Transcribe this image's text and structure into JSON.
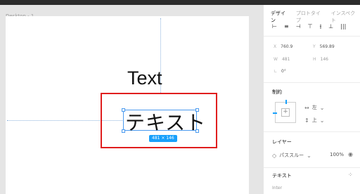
{
  "canvas": {
    "frame_label": "Desktop - 1",
    "text_en": "Text",
    "text_jp": "テキスト",
    "dimensions_badge": "481 × 146"
  },
  "panel": {
    "tabs": [
      {
        "label": "デザイン",
        "active": true
      },
      {
        "label": "プロトタイプ",
        "active": false
      },
      {
        "label": "インスペクト",
        "active": false
      }
    ],
    "align_icons": [
      "⊢",
      "≡",
      "⊣",
      "⊤",
      "⫲",
      "⊥",
      "|||"
    ],
    "position": {
      "x_label": "X",
      "x_value": "760.9",
      "y_label": "Y",
      "y_value": "569.89"
    },
    "size": {
      "w_label": "W",
      "w_value": "481",
      "h_label": "H",
      "h_value": "146"
    },
    "rotation": {
      "label": "∟",
      "value": "0°"
    },
    "constraints": {
      "title": "制約",
      "horizontal": "左",
      "vertical": "上"
    },
    "layer": {
      "title": "レイヤー",
      "blend": "パススルー",
      "opacity": "100%"
    },
    "text_section": {
      "title": "テキスト",
      "font": "Inter"
    }
  }
}
